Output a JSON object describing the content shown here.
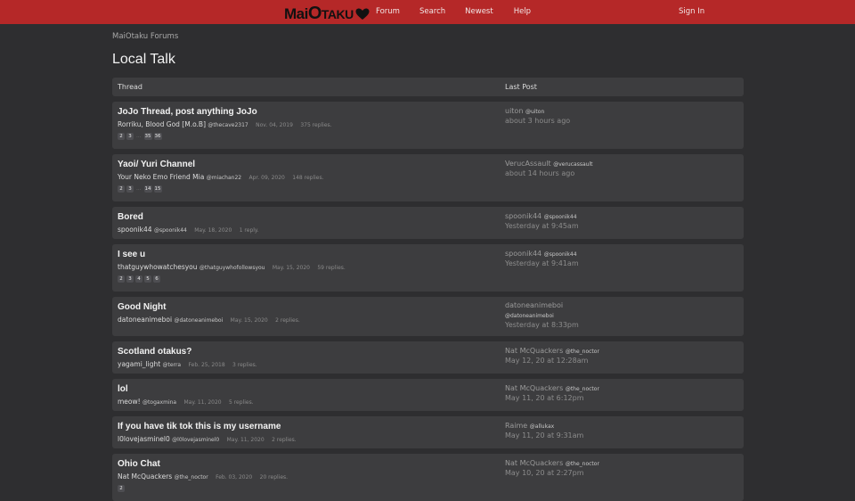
{
  "topbar": {
    "logo_text_a": "Mai",
    "logo_text_b": "O",
    "logo_text_c": "taku",
    "nav": [
      "Forum",
      "Search",
      "Newest",
      "Help"
    ],
    "signin": "Sign In"
  },
  "breadcrumb": "MaiOtaku Forums",
  "page_title": "Local Talk",
  "columns": {
    "thread": "Thread",
    "last_post": "Last Post"
  },
  "threads": [
    {
      "title": "JoJo Thread, post anything JoJo",
      "author": "Rorriku, Blood God [M.o.B]",
      "handle": "@thecave2317",
      "date": "Nov. 04, 2019",
      "replies": "375 replies.",
      "pages": [
        "2",
        "3",
        "…",
        "35",
        "36"
      ],
      "last_user": "uiton",
      "last_handle": "@uiton",
      "last_time": "about 3 hours ago"
    },
    {
      "title": "Yaoi/ Yuri Channel",
      "author": "Your Neko Emo Friend Mia",
      "handle": "@miachan22",
      "date": "Apr. 09, 2020",
      "replies": "148 replies.",
      "pages": [
        "2",
        "3",
        "…",
        "14",
        "15"
      ],
      "last_user": "VerucAssault",
      "last_handle": "@verucassault",
      "last_time": "about 14 hours ago"
    },
    {
      "title": "Bored",
      "author": "spoonik44",
      "handle": "@spoonik44",
      "date": "May. 18, 2020",
      "replies": "1 reply.",
      "pages": [],
      "last_user": "spoonik44",
      "last_handle": "@spoonik44",
      "last_time": "Yesterday at 9:45am"
    },
    {
      "title": "I see u",
      "author": "thatguywhowatchesyou",
      "handle": "@thatguywhofollowsyou",
      "date": "May. 15, 2020",
      "replies": "59 replies.",
      "pages": [
        "2",
        "3",
        "4",
        "5",
        "6"
      ],
      "last_user": "spoonik44",
      "last_handle": "@spoonik44",
      "last_time": "Yesterday at 9:41am"
    },
    {
      "title": "Good Night",
      "author": "datoneanimeboi",
      "handle": "@datoneanimeboi",
      "date": "May. 15, 2020",
      "replies": "2 replies.",
      "pages": [],
      "last_user": "datoneanimeboi",
      "last_handle": "@datoneanimeboi",
      "last_time": "Yesterday at 8:33pm"
    },
    {
      "title": "Scotland otakus?",
      "author": "yagami_light",
      "handle": "@terra",
      "date": "Feb. 25, 2018",
      "replies": "3 replies.",
      "pages": [],
      "last_user": "Nat McQuackers",
      "last_handle": "@the_noctor",
      "last_time": "May 12, 20 at 12:28am"
    },
    {
      "title": "lol",
      "author": "meow!",
      "handle": "@togaxmina",
      "date": "May. 11, 2020",
      "replies": "5 replies.",
      "pages": [],
      "last_user": "Nat McQuackers",
      "last_handle": "@the_noctor",
      "last_time": "May 11, 20 at 6:12pm"
    },
    {
      "title": "If you have tik tok this is my username",
      "author": "l0lovejasminel0",
      "handle": "@l0lovejasminel0",
      "date": "May. 11, 2020",
      "replies": "2 replies.",
      "pages": [],
      "last_user": "Raime",
      "last_handle": "@allukax",
      "last_time": "May 11, 20 at 9:31am"
    },
    {
      "title": "Ohio Chat",
      "author": "Nat McQuackers",
      "handle": "@the_noctor",
      "date": "Feb. 03, 2020",
      "replies": "20 replies.",
      "pages": [
        "2"
      ],
      "last_user": "Nat McQuackers",
      "last_handle": "@the_noctor",
      "last_time": "May 10, 20 at 2:27pm"
    }
  ],
  "colors": {
    "topbar": "#b52828",
    "background": "#2e2e30",
    "row": "#3d3d3f"
  }
}
